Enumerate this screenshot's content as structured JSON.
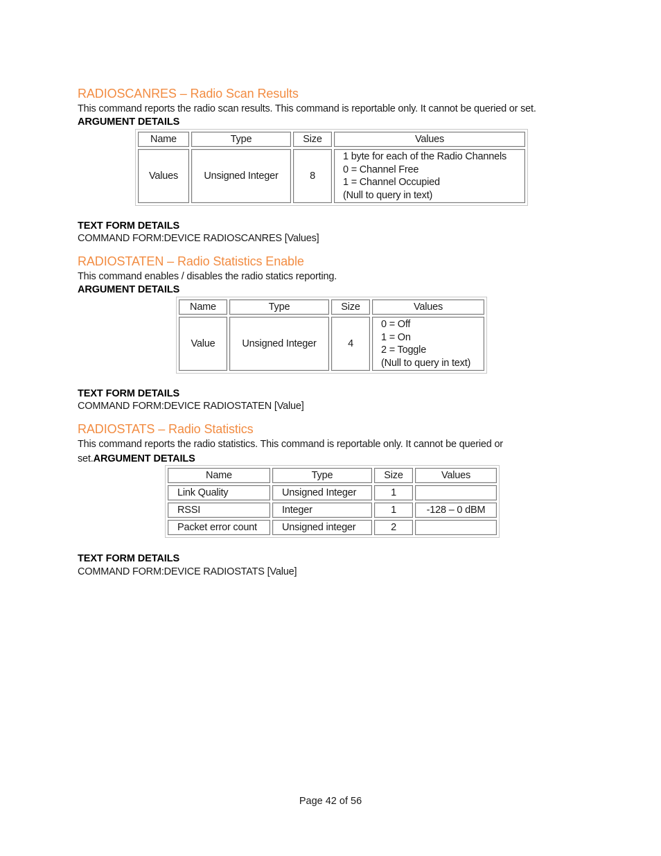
{
  "sections": [
    {
      "heading": "RADIOSCANRES – Radio Scan Results",
      "description": "This command reports the radio scan results. This command is reportable only. It cannot be queried or set.",
      "argument_details_label": "ARGUMENT DETAILS",
      "table": {
        "headers": [
          "Name",
          "Type",
          "Size",
          "Values"
        ],
        "rows": [
          {
            "name": "Values",
            "type": "Unsigned Integer",
            "size": "8",
            "values": [
              "1 byte for each of the Radio Channels",
              "0 = Channel Free",
              "1 = Channel Occupied",
              "(Null to query in text)"
            ]
          }
        ]
      },
      "text_form_label": "TEXT FORM DETAILS",
      "command_form": "COMMAND FORM:DEVICE RADIOSCANRES [Values]"
    },
    {
      "heading": "RADIOSTATEN – Radio Statistics Enable",
      "description": "This command enables / disables the radio statics reporting.",
      "argument_details_label": "ARGUMENT DETAILS",
      "table": {
        "headers": [
          "Name",
          "Type",
          "Size",
          "Values"
        ],
        "rows": [
          {
            "name": "Value",
            "type": "Unsigned Integer",
            "size": "4",
            "values": [
              "0 = Off",
              "1 = On",
              "2 = Toggle",
              "(Null to query in text)"
            ]
          }
        ]
      },
      "text_form_label": "TEXT FORM DETAILS",
      "command_form": "COMMAND FORM:DEVICE RADIOSTATEN [Value]"
    },
    {
      "heading": "RADIOSTATS – Radio Statistics",
      "description_line1": "This command reports the radio statistics.  This command is reportable only.  It cannot be queried or",
      "description_line2": "set.",
      "argument_details_label": "ARGUMENT DETAILS",
      "table": {
        "headers": [
          "Name",
          "Type",
          "Size",
          "Values"
        ],
        "rows": [
          {
            "name": "Link Quality",
            "type": "Unsigned Integer",
            "size": "1",
            "values": ""
          },
          {
            "name": "RSSI",
            "type": "Integer",
            "size": "1",
            "values": "-128 – 0 dBM"
          },
          {
            "name": "Packet error count",
            "type": "Unsigned integer",
            "size": "2",
            "values": ""
          }
        ]
      },
      "text_form_label": "TEXT FORM DETAILS",
      "command_form": "COMMAND FORM:DEVICE RADIOSTATS [Value]"
    }
  ],
  "footer": {
    "page_label": "Page 42 of 56"
  }
}
